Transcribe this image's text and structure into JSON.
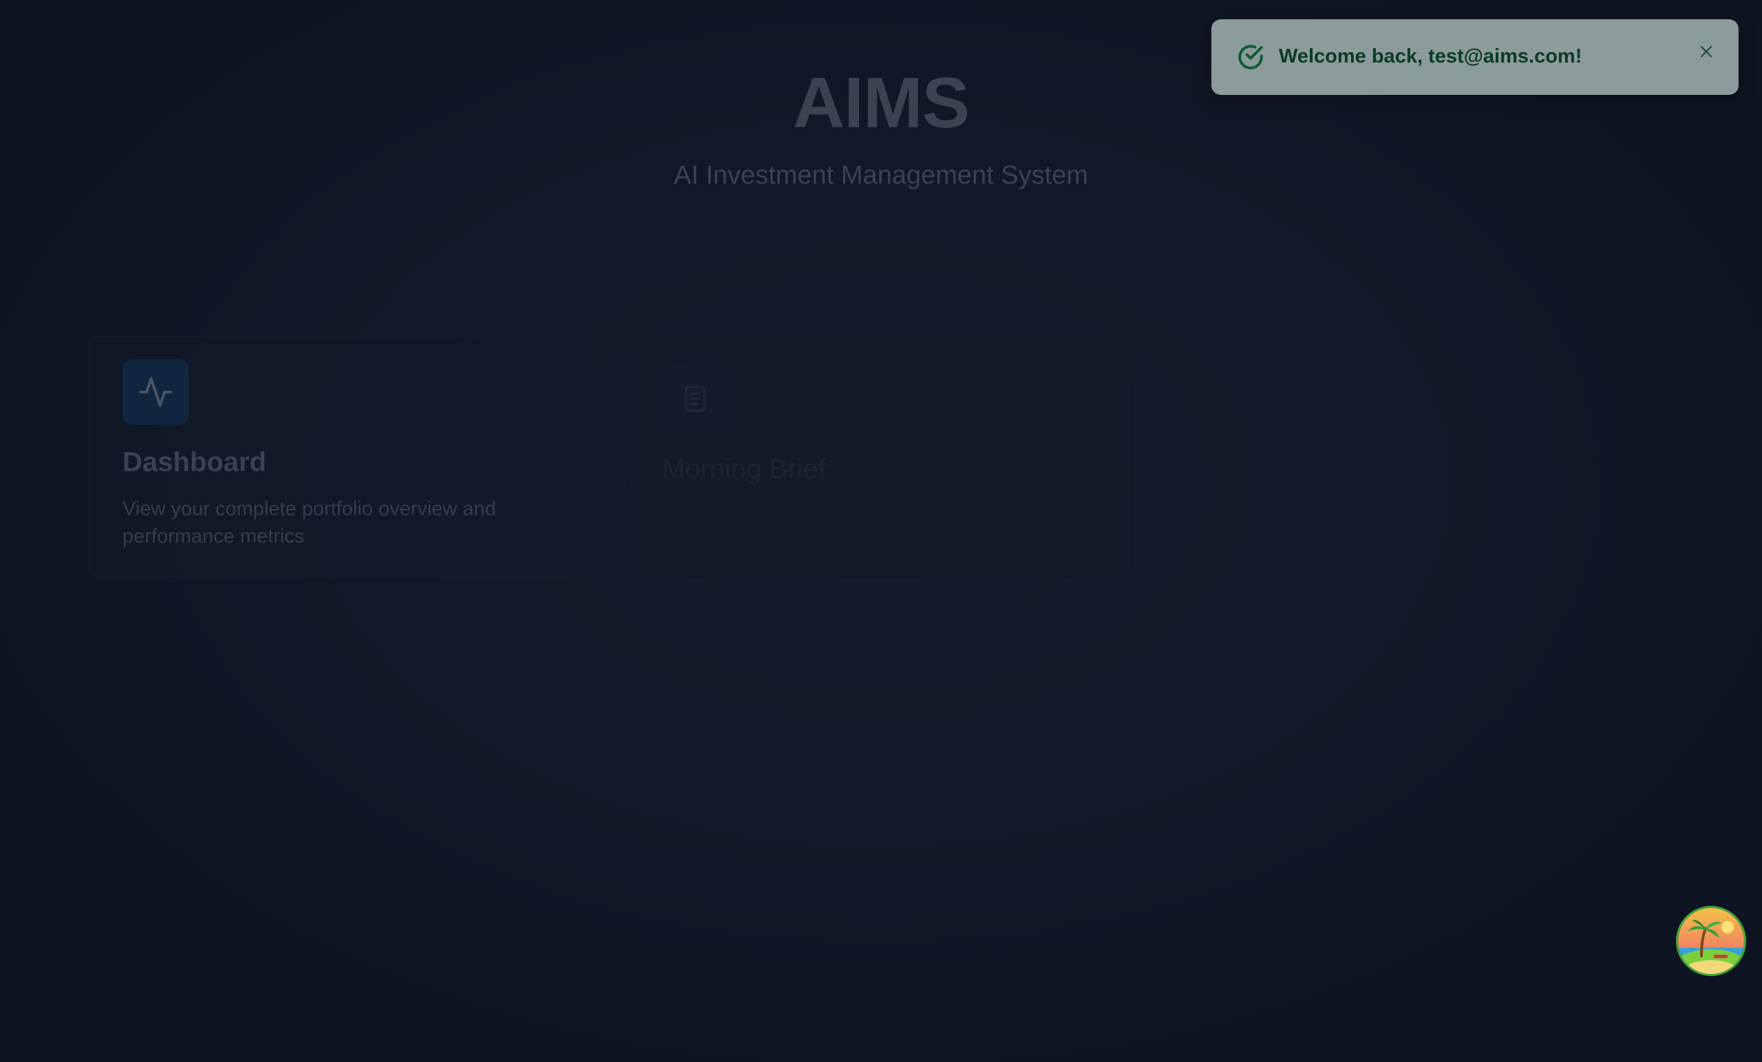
{
  "app": {
    "title": "AIMS",
    "subtitle": "AI Investment Management System"
  },
  "cards": [
    {
      "title": "Dashboard",
      "description": "View your complete portfolio overview and performance metrics",
      "icon": "activity-icon"
    },
    {
      "title": "Morning Brief",
      "description": "",
      "icon": "document-icon"
    }
  ],
  "toast": {
    "message": "Welcome back, test@aims.com!",
    "icon": "check-circle-icon",
    "close_icon": "close-icon",
    "text_color": "#0c3b28",
    "background": "#8b9a9b"
  },
  "floating_button": {
    "icon": "beach-avatar-icon"
  }
}
